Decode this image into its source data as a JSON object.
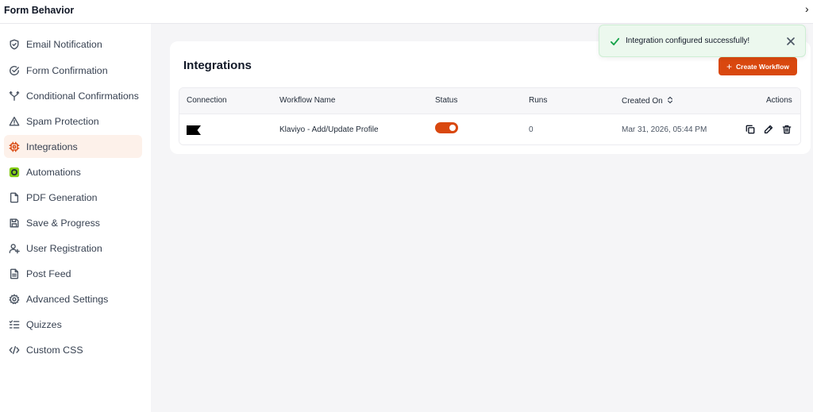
{
  "header": {
    "title": "Form Behavior",
    "close_glyph": "›"
  },
  "sidebar": {
    "items": [
      {
        "label": "Email Notification",
        "icon": "shield-icon"
      },
      {
        "label": "Form Confirmation",
        "icon": "check-circle-icon"
      },
      {
        "label": "Conditional Confirmations",
        "icon": "branch-icon"
      },
      {
        "label": "Spam Protection",
        "icon": "warning-icon"
      },
      {
        "label": "Integrations",
        "icon": "integrations-icon",
        "active": true
      },
      {
        "label": "Automations",
        "icon": "automations-icon"
      },
      {
        "label": "PDF Generation",
        "icon": "file-icon"
      },
      {
        "label": "Save & Progress",
        "icon": "save-icon"
      },
      {
        "label": "User Registration",
        "icon": "user-plus-icon"
      },
      {
        "label": "Post Feed",
        "icon": "document-icon"
      },
      {
        "label": "Advanced Settings",
        "icon": "gear-icon"
      },
      {
        "label": "Quizzes",
        "icon": "checklist-icon"
      },
      {
        "label": "Custom CSS",
        "icon": "code-icon"
      }
    ]
  },
  "main": {
    "title": "Integrations",
    "create_button": "Create Workflow",
    "table": {
      "headers": {
        "connection": "Connection",
        "workflow_name": "Workflow Name",
        "status": "Status",
        "runs": "Runs",
        "created_on": "Created On",
        "actions": "Actions"
      },
      "rows": [
        {
          "connection_icon": "klaviyo-flag-icon",
          "workflow_name": "Klaviyo - Add/Update Profile",
          "status_enabled": true,
          "runs": "0",
          "created_on": "Mar 31, 2026, 05:44 PM"
        }
      ]
    }
  },
  "toast": {
    "message": "Integration configured successfully!"
  },
  "colors": {
    "accent": "#d9480f",
    "toast_bg": "#ecf8ee",
    "success": "#16a34a",
    "active_bg": "#fdf1ea",
    "automations_badge": "#84cc16"
  }
}
